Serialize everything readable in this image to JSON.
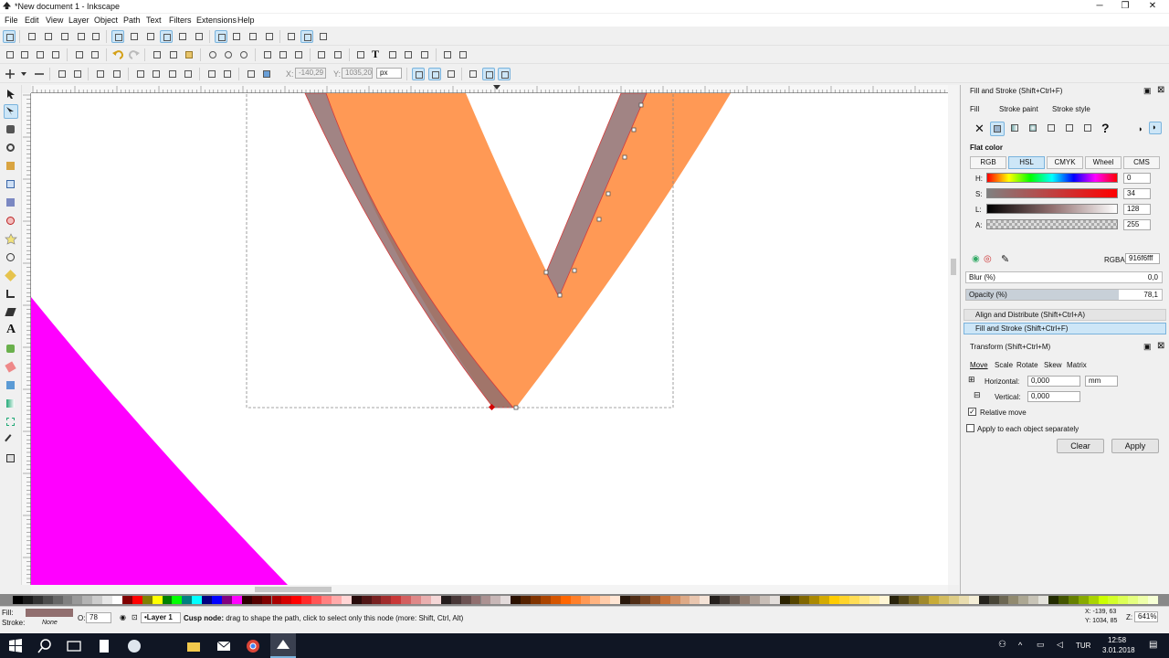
{
  "window": {
    "title": "*New document 1 - Inkscape",
    "minimize": "─",
    "maximize": "❐",
    "close": "✕"
  },
  "menu": [
    "File",
    "Edit",
    "View",
    "Layer",
    "Object",
    "Path",
    "Text",
    "Filters",
    "Extensions",
    "Help"
  ],
  "toolctrls": {
    "x_label": "X:",
    "x_value": "-140,29",
    "y_label": "Y:",
    "y_value": "1035,20",
    "unit": "px"
  },
  "panel": {
    "fillstroke_title": "Fill and Stroke (Shift+Ctrl+F)",
    "tabs": {
      "fill": "Fill",
      "stroke_paint": "Stroke paint",
      "stroke_style": "Stroke style"
    },
    "paint_kind": "Flat color",
    "modes": [
      "RGB",
      "HSL",
      "CMYK",
      "Wheel",
      "CMS"
    ],
    "active_mode": "HSL",
    "sliders": [
      {
        "label": "H:",
        "value": "0"
      },
      {
        "label": "S:",
        "value": "34"
      },
      {
        "label": "L:",
        "value": "128"
      },
      {
        "label": "A:",
        "value": "255"
      }
    ],
    "rgba_label": "RGBA:",
    "rgba_value": "916f6fff",
    "blur_label": "Blur (%)",
    "blur_value": "0,0",
    "opacity_label": "Opacity (%)",
    "opacity_value": "78,1",
    "opacity_fraction": 0.781,
    "docked_align": "Align and Distribute (Shift+Ctrl+A)",
    "docked_fillstroke": "Fill and Stroke (Shift+Ctrl+F)",
    "transform_title": "Transform (Shift+Ctrl+M)",
    "transform_tabs": [
      "Move",
      "Scale",
      "Rotate",
      "Skew",
      "Matrix"
    ],
    "horizontal_label": "Horizontal:",
    "horizontal_value": "0,000",
    "vertical_label": "Vertical:",
    "vertical_value": "0,000",
    "unit": "mm",
    "relative_move": "Relative move",
    "apply_each": "Apply to each object separately",
    "clear": "Clear",
    "apply": "Apply"
  },
  "status": {
    "fill_label": "Fill:",
    "stroke_label": "Stroke:",
    "stroke_value": "None",
    "opacity_label": "O:",
    "opacity_value": "78",
    "layer": "•Layer 1",
    "message_bold": "Cusp node:",
    "message": " drag to shape the path, click to select only this node (more: Shift, Ctrl, Alt)",
    "coord_x": "X: -139, 63",
    "coord_y": "Y: 1034, 85",
    "zoom_label": "Z:",
    "zoom_value": "641%"
  },
  "taskbar": {
    "lang": "TUR",
    "time": "12:58",
    "date": "3.01.2018"
  },
  "colors": {
    "orange": "#ff9955",
    "fill_color": "#916f6f",
    "magenta": "#ff00ff",
    "accent": "#cde6f7"
  }
}
